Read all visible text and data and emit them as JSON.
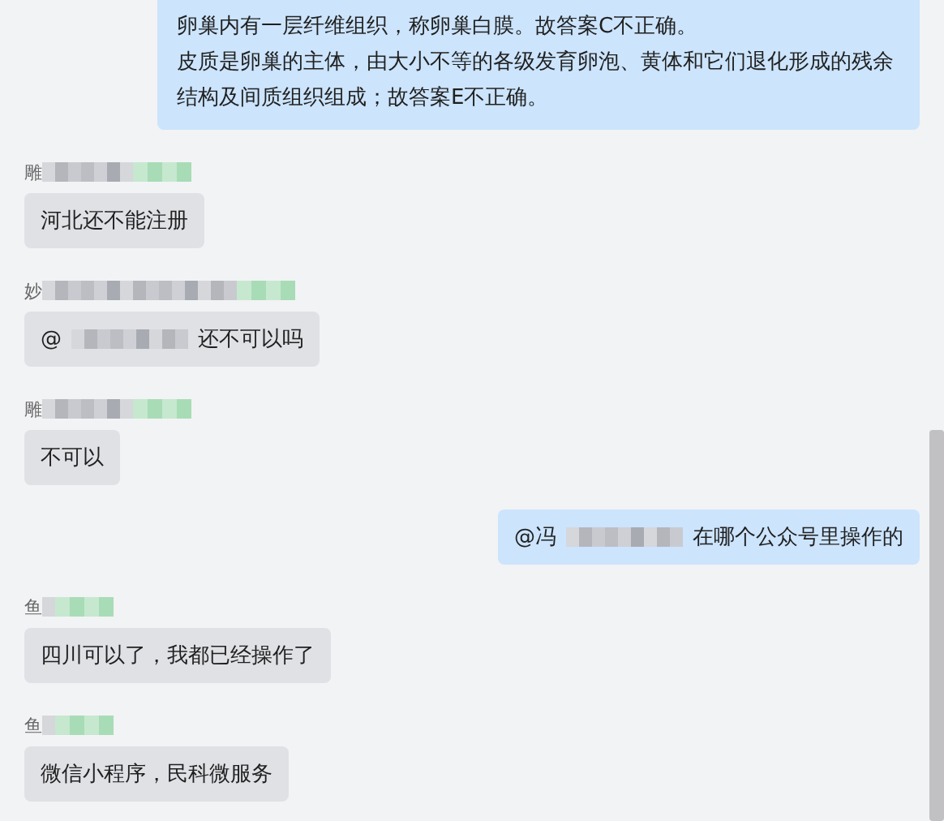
{
  "top_message": {
    "lines": [
      "卵巢内有一层纤维组织，称卵巢白膜。故答案C不正确。",
      "皮质是卵巢的主体，由大小不等的各级发育卵泡、黄体和它们退化形成的残余",
      "结构及间质组织组成；故答案E不正确。"
    ]
  },
  "messages": [
    {
      "kind": "incoming",
      "sender": "雕",
      "text": "河北还不能注册"
    },
    {
      "kind": "incoming",
      "sender": "妙",
      "mention": "@",
      "text": "还不可以吗"
    },
    {
      "kind": "incoming",
      "sender": "雕",
      "text": "不可以"
    },
    {
      "kind": "outgoing",
      "mention": "@冯",
      "text": "在哪个公众号里操作的"
    },
    {
      "kind": "incoming",
      "sender": "鱼",
      "text": "四川可以了，我都已经操作了"
    },
    {
      "kind": "incoming",
      "sender": "鱼",
      "text": "微信小程序，民科微服务"
    }
  ]
}
